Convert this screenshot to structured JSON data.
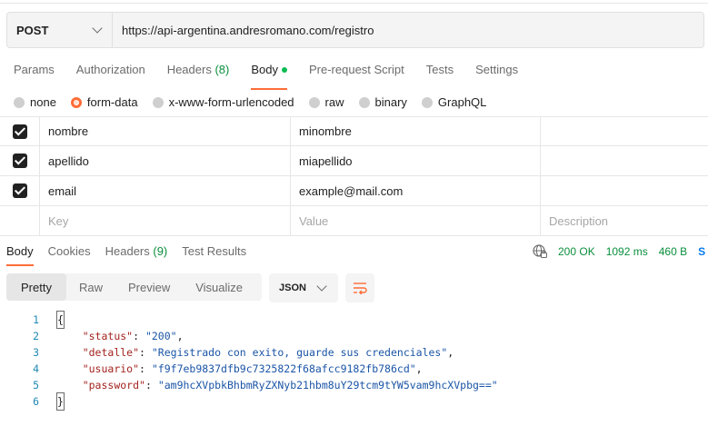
{
  "request": {
    "method": "POST",
    "url": "https://api-argentina.andresromano.com/registro"
  },
  "request_tabs": [
    {
      "label": "Params"
    },
    {
      "label": "Authorization"
    },
    {
      "label": "Headers",
      "count": "(8)"
    },
    {
      "label": "Body",
      "active": true
    },
    {
      "label": "Pre-request Script"
    },
    {
      "label": "Tests"
    },
    {
      "label": "Settings"
    }
  ],
  "body_types": [
    "none",
    "form-data",
    "x-www-form-urlencoded",
    "raw",
    "binary",
    "GraphQL"
  ],
  "body_type_selected": "form-data",
  "form_rows": [
    {
      "key": "nombre",
      "value": "minombre",
      "checked": true
    },
    {
      "key": "apellido",
      "value": "miapellido",
      "checked": true
    },
    {
      "key": "email",
      "value": "example@mail.com",
      "checked": true
    }
  ],
  "placeholders": {
    "key": "Key",
    "value": "Value",
    "description": "Description"
  },
  "response_tabs": [
    {
      "label": "Body",
      "active": true
    },
    {
      "label": "Cookies"
    },
    {
      "label": "Headers",
      "count": "(9)"
    },
    {
      "label": "Test Results"
    }
  ],
  "response_status": {
    "code": "200 OK",
    "time": "1092 ms",
    "size": "460 B",
    "cut_label": "S"
  },
  "format_buttons": [
    "Pretty",
    "Raw",
    "Preview",
    "Visualize"
  ],
  "format_selected": "Pretty",
  "language": "JSON",
  "code_lines": [
    {
      "n": "1",
      "open": "{"
    },
    {
      "n": "2",
      "key": "\"status\"",
      "val": "\"200\"",
      "comma": ","
    },
    {
      "n": "3",
      "key": "\"detalle\"",
      "val": "\"Registrado con exito, guarde sus credenciales\"",
      "comma": ","
    },
    {
      "n": "4",
      "key": "\"usuario\"",
      "val": "\"f9f7eb9837dfb9c7325822f68afcc9182fb786cd\"",
      "comma": ","
    },
    {
      "n": "5",
      "key": "\"password\"",
      "val": "\"am9hcXVpbkBhbmRyZXNyb21hbm8uY29tcm9tYW5vam9hcXVpbg==\"",
      "comma": ""
    },
    {
      "n": "6",
      "close": "}"
    }
  ],
  "colors": {
    "accent": "#ff6c37",
    "success": "#0a8f3c",
    "key": "#a3241f",
    "string": "#1b55a6"
  }
}
